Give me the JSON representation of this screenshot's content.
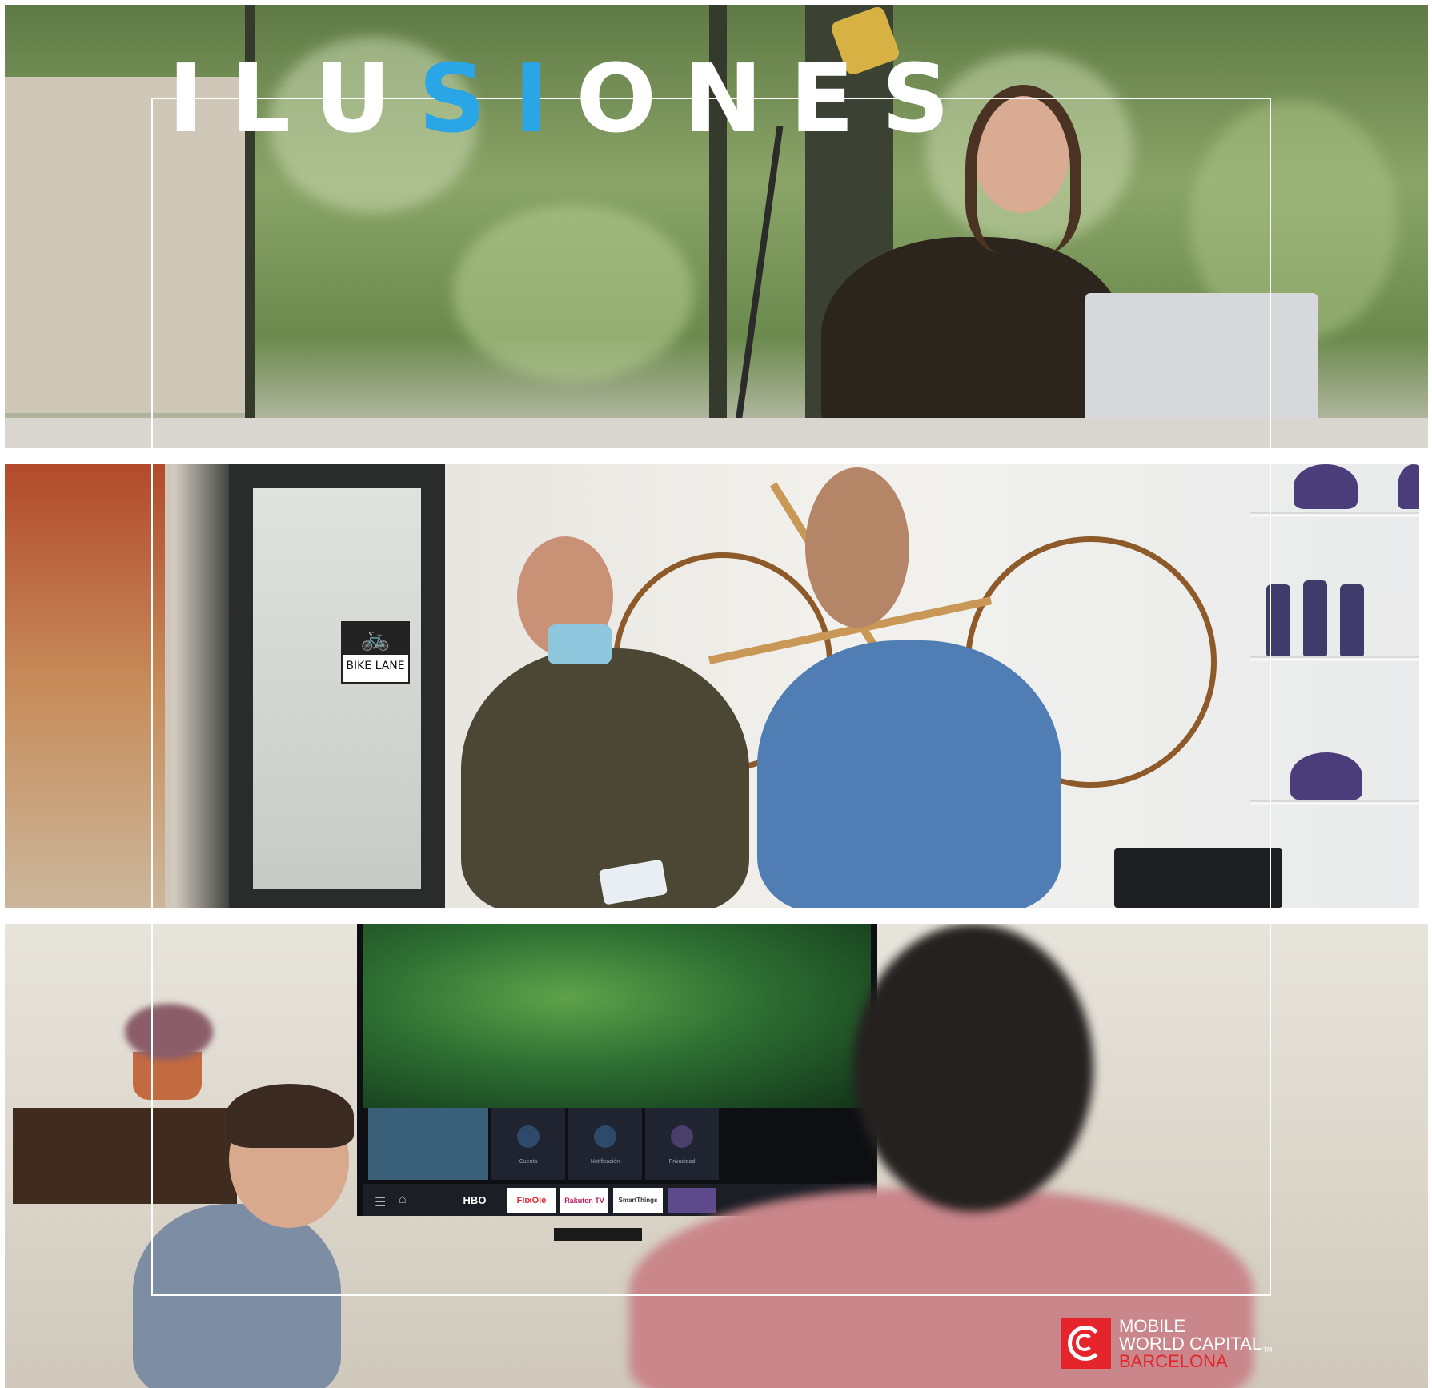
{
  "title": {
    "part1": "ILU",
    "part2": "SI",
    "part3": "ONES",
    "white_color": "#ffffff",
    "accent_color": "#2aa6e6"
  },
  "panel2": {
    "sign_text": "BIKE LANE"
  },
  "panel3": {
    "tv_menu": [
      "Cuenta",
      "Notificación",
      "Privacidad"
    ],
    "tv_apps": [
      "HBO",
      "FlixOlé",
      "Rakuten TV",
      "SmartThings"
    ]
  },
  "logo": {
    "line1": "MOBILE",
    "line2": "WORLD CAPITAL",
    "tm": "TM",
    "line3": "BARCELONA",
    "brand_color": "#e5242c"
  }
}
